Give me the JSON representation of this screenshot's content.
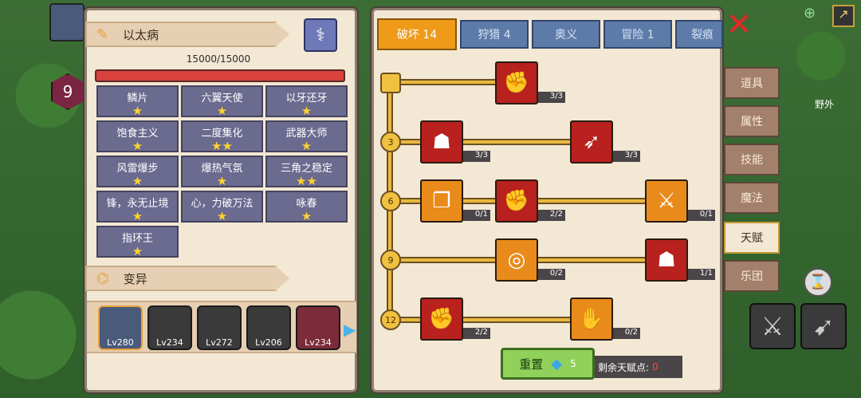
{
  "player": {
    "level": "9"
  },
  "disease": {
    "title": "以太病",
    "hp_text": "15000/15000"
  },
  "traits": [
    {
      "name": "鳞片",
      "stars": "★"
    },
    {
      "name": "六翼天使",
      "stars": "★"
    },
    {
      "name": "以牙还牙",
      "stars": "★"
    },
    {
      "name": "饱食主义",
      "stars": "★"
    },
    {
      "name": "二度集化",
      "stars": "★★"
    },
    {
      "name": "武器大师",
      "stars": "★"
    },
    {
      "name": "风雷爆步",
      "stars": "★"
    },
    {
      "name": "爆热气氛",
      "stars": "★"
    },
    {
      "name": "三角之稳定",
      "stars": "★★"
    },
    {
      "name": "锋，永无止境",
      "stars": "★"
    },
    {
      "name": "心，力破万法",
      "stars": "★"
    },
    {
      "name": "咏春",
      "stars": "★"
    },
    {
      "name": "指环王",
      "stars": "★"
    }
  ],
  "mutation": {
    "title": "变异"
  },
  "pets": [
    "Lv280",
    "Lv234",
    "Lv272",
    "Lv206",
    "Lv234"
  ],
  "tabs": [
    "破坏 14",
    "狩猎 4",
    "奥义",
    "冒险 1",
    "裂痕"
  ],
  "tiers": [
    "3",
    "6",
    "9",
    "12"
  ],
  "talents": [
    "3/3",
    "3/3",
    "3/3",
    "0/1",
    "2/2",
    "0/1",
    "0/2",
    "1/1",
    "2/2",
    "0/2"
  ],
  "reset": {
    "label": "重置",
    "cost": "5"
  },
  "points": {
    "label": "剩余天赋点:",
    "value": "0"
  },
  "side_tabs": [
    "道具",
    "属性",
    "技能",
    "魔法",
    "天赋",
    "乐团"
  ],
  "hud": {
    "map_label": "野外"
  }
}
